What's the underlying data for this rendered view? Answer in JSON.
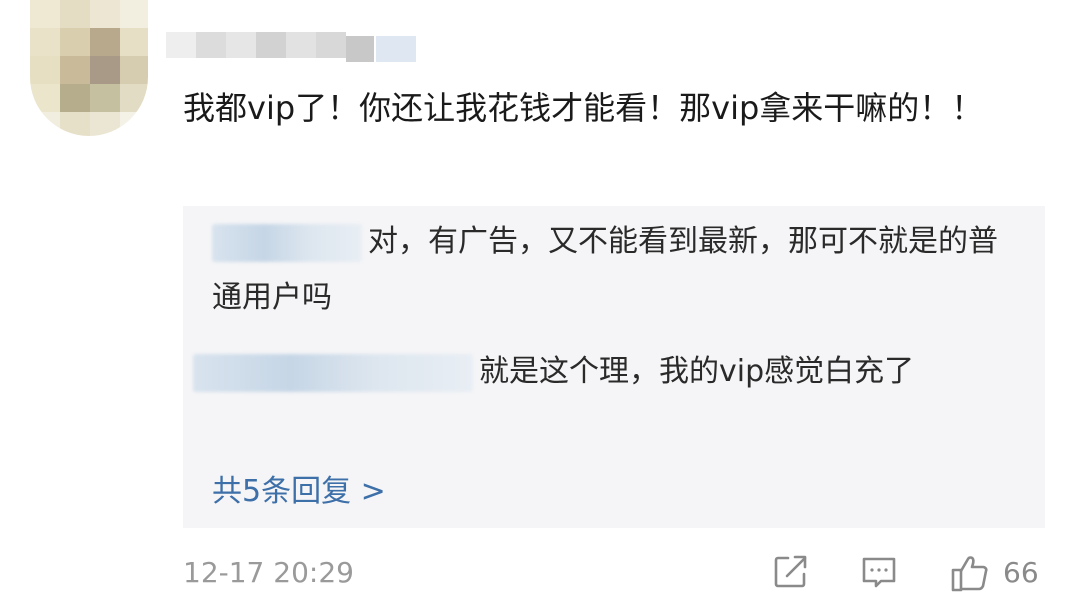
{
  "comment": {
    "author_badge": "",
    "text": "我都vip了！你还让我花钱才能看！那vip拿来干嘛的！！"
  },
  "replies": [
    {
      "text": "对，有广告，又不能看到最新，那可不就是的普通用户吗"
    },
    {
      "text": "就是这个理，我的vip感觉白充了"
    }
  ],
  "more_replies_label": "共5条回复 >",
  "footer": {
    "timestamp": "12-17 20:29",
    "like_count": "66"
  },
  "icons": {
    "share": "share-icon",
    "reply": "comment-icon",
    "like": "thumbs-up-icon"
  },
  "colors": {
    "link": "#3d6fa8",
    "reply_background": "#f5f5f7",
    "meta_text": "#9a9a9a"
  }
}
